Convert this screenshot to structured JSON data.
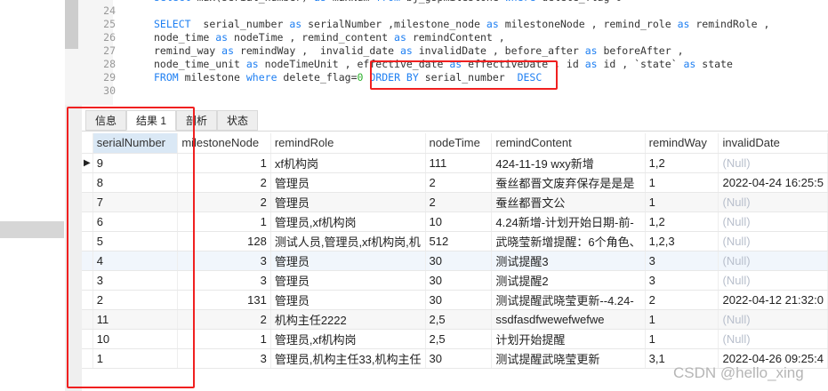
{
  "editor": {
    "lines": [
      {
        "n": "24",
        "t": ""
      },
      {
        "n": "25",
        "t": ""
      },
      {
        "n": "26",
        "t": ""
      },
      {
        "n": "27",
        "t": ""
      },
      {
        "n": "28",
        "t": ""
      },
      {
        "n": "29",
        "t": ""
      },
      {
        "n": "30",
        "t": ""
      }
    ]
  },
  "tabs": [
    "信息",
    "结果 1",
    "剖析",
    "状态"
  ],
  "columns": [
    "serialNumber",
    "milestoneNode",
    "remindRole",
    "nodeTime",
    "remindContent",
    "remindWay",
    "invalidDate"
  ],
  "rows": [
    [
      "9",
      "1",
      "xf机构岗",
      "111",
      "424-11-19 wxy新增",
      "1,2",
      "(Null)"
    ],
    [
      "8",
      "2",
      "管理员",
      "2",
      "蚕丝都晋文废弃保存是是是",
      "1",
      "2022-04-24 16:25:5"
    ],
    [
      "7",
      "2",
      "管理员",
      "2",
      "蚕丝都晋文公",
      "1",
      "(Null)"
    ],
    [
      "6",
      "1",
      "管理员,xf机构岗",
      "10",
      "4.24新增-计划开始日期-前-",
      "1,2",
      "(Null)"
    ],
    [
      "5",
      "128",
      "测试人员,管理员,xf机构岗,机",
      "512",
      "武晓莹新增提醒：6个角色、",
      "1,2,3",
      "(Null)"
    ],
    [
      "4",
      "3",
      "管理员",
      "30",
      "测试提醒3",
      "3",
      "(Null)"
    ],
    [
      "3",
      "3",
      "管理员",
      "30",
      "测试提醒2",
      "3",
      "(Null)"
    ],
    [
      "2",
      "131",
      "管理员",
      "30",
      "测试提醒武晓莹更新--4.24-",
      "2",
      "2022-04-12 21:32:0"
    ],
    [
      "11",
      "2",
      "机构主任2222",
      "2,5",
      "ssdfasdfwewefwefwe",
      "1",
      "(Null)"
    ],
    [
      "10",
      "1",
      "管理员,xf机构岗",
      "2,5",
      "计划开始提醒",
      "1",
      "(Null)"
    ],
    [
      "1",
      "3",
      "管理员,机构主任33,机构主任",
      "30",
      "测试提醒武晓莹更新",
      "3,1",
      "(Null)"
    ]
  ],
  "row_last_invalid": "2022-04-26 09:25:4",
  "watermark": "CSDN @hello_xing"
}
